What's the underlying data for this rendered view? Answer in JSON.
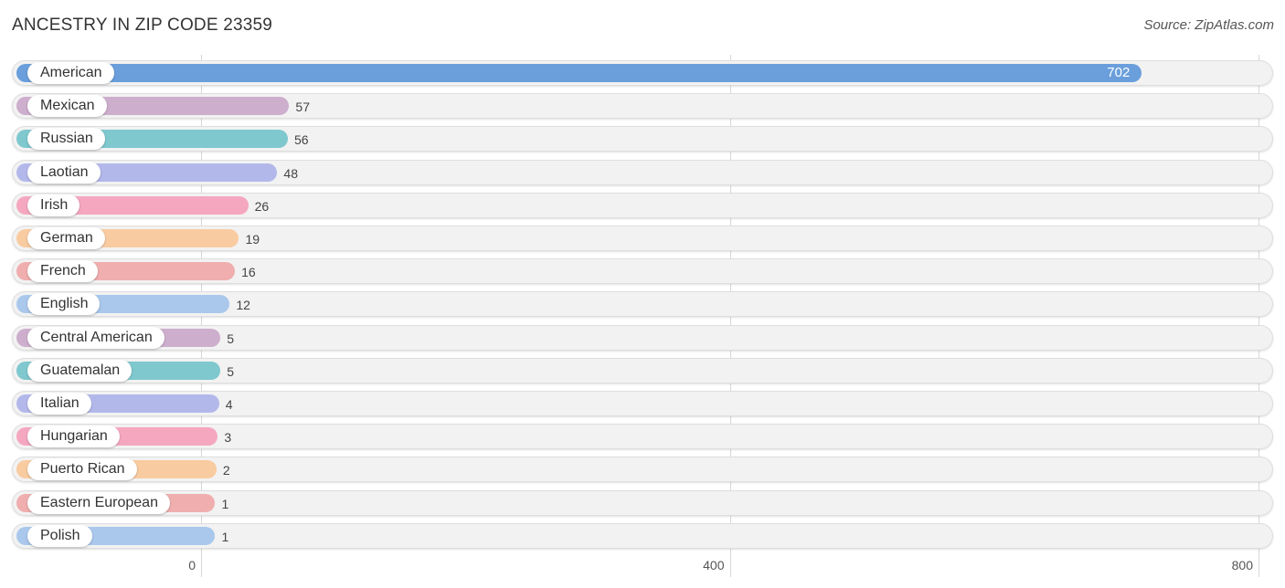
{
  "title": "ANCESTRY IN ZIP CODE 23359",
  "source": "Source: ZipAtlas.com",
  "chart_data": {
    "type": "bar",
    "orientation": "horizontal",
    "title": "ANCESTRY IN ZIP CODE 23359",
    "xlabel": "",
    "ylabel": "",
    "xlim": [
      0,
      800
    ],
    "xticks": [
      0,
      400,
      800
    ],
    "grid": true,
    "categories": [
      "American",
      "Mexican",
      "Russian",
      "Laotian",
      "Irish",
      "German",
      "French",
      "English",
      "Central American",
      "Guatemalan",
      "Italian",
      "Hungarian",
      "Puerto Rican",
      "Eastern European",
      "Polish"
    ],
    "values": [
      702,
      57,
      56,
      48,
      26,
      19,
      16,
      12,
      5,
      5,
      4,
      3,
      2,
      1,
      1
    ],
    "colors": [
      "#6a9fdc",
      "#cdaecd",
      "#7ec8ce",
      "#b3b8eb",
      "#f5a7c0",
      "#f9cba0",
      "#f0aeae",
      "#a9c8ec",
      "#cdaecd",
      "#7ec8ce",
      "#b3b8eb",
      "#f5a7c0",
      "#f9cba0",
      "#f0aeae",
      "#a9c8ec"
    ]
  }
}
